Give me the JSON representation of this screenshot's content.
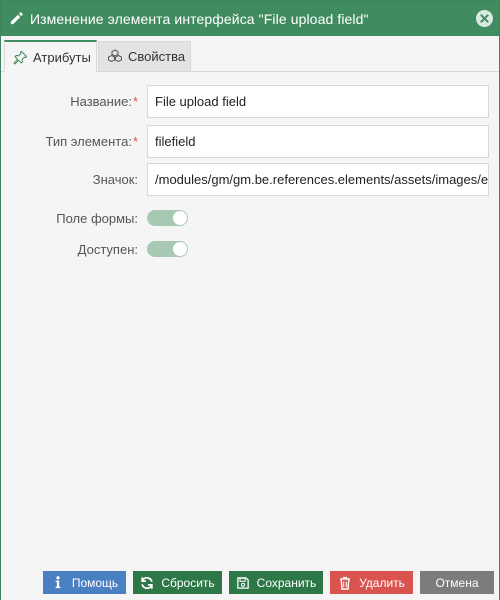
{
  "window": {
    "title": "Изменение элемента интерфейса \"File upload field\"",
    "accent_color": "#418b60"
  },
  "tabs": [
    {
      "label": "Атрибуты",
      "icon": "pin-icon",
      "active": true
    },
    {
      "label": "Свойства",
      "icon": "cubes-icon",
      "active": false
    }
  ],
  "form": {
    "name": {
      "label": "Название:",
      "required": "*",
      "value": "File upload field"
    },
    "type": {
      "label": "Тип элемента:",
      "required": "*",
      "value": "filefield"
    },
    "icon": {
      "label": "Значок:",
      "value": "/modules/gm/gm.be.references.elements/assets/images/elements/filefield.svg"
    },
    "form_field": {
      "label": "Поле формы:",
      "on": true
    },
    "enabled": {
      "label": "Доступен:",
      "on": true
    }
  },
  "buttons": {
    "help": "Помощь",
    "reset": "Сбросить",
    "save": "Сохранить",
    "delete": "Удалить",
    "cancel": "Отмена"
  }
}
